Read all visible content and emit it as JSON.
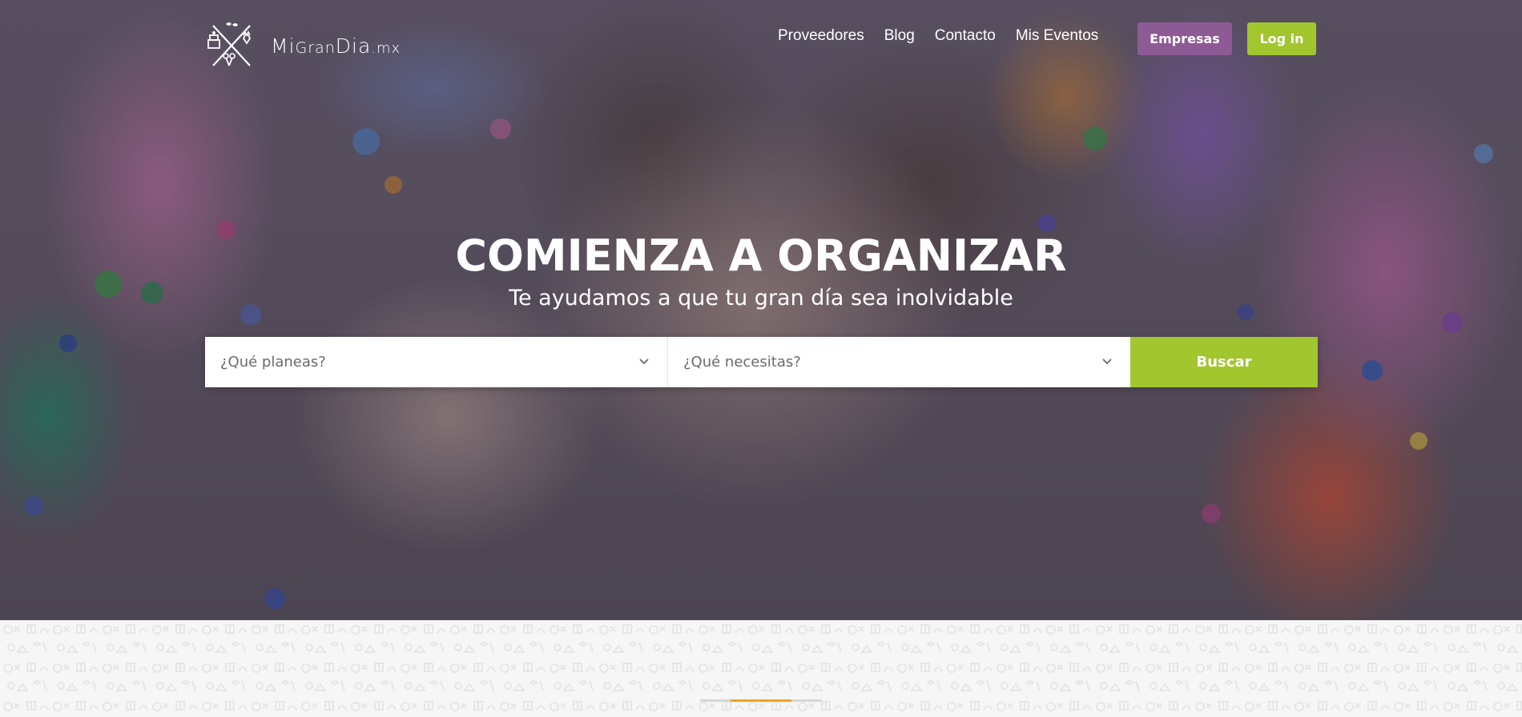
{
  "brand": {
    "logo_alt": "MiGranDia.mx",
    "logo_text": {
      "part1": "Mi",
      "part2": "Gran",
      "part3": "Dia",
      "part4": ".mx"
    }
  },
  "nav": {
    "items": [
      {
        "label": "Proveedores"
      },
      {
        "label": "Blog"
      },
      {
        "label": "Contacto"
      },
      {
        "label": "Mis Eventos"
      }
    ],
    "empresas_label": "Empresas",
    "login_label": "Log in"
  },
  "hero": {
    "title": "COMIENZA A ORGANIZAR",
    "subtitle": "Te ayudamos a que tu gran día sea inolvidable"
  },
  "search": {
    "event_placeholder": "¿Qué planeas?",
    "service_placeholder": "¿Qué necesitas?",
    "button_label": "Buscar"
  },
  "slider": {
    "active_fraction_start": 0.25,
    "active_fraction_end": 0.75
  },
  "colors": {
    "accent_green": "#a2c62e",
    "accent_purple": "#8e5a95",
    "indicator_orange": "#f2a224"
  }
}
